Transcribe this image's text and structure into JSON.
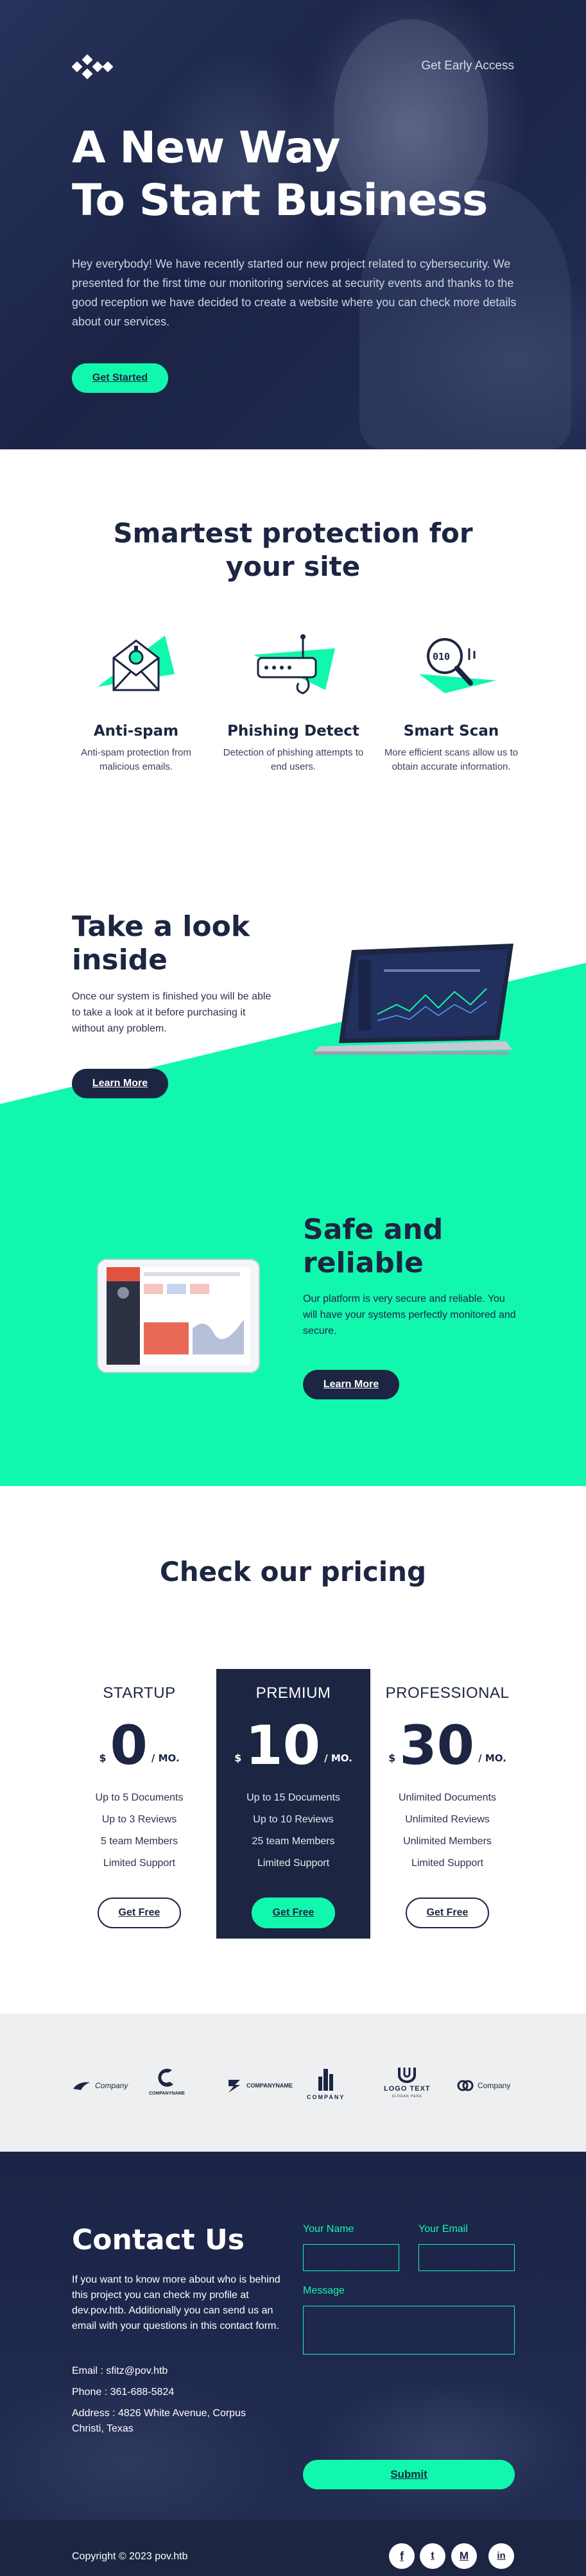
{
  "nav": {
    "link": "Get Early Access"
  },
  "hero": {
    "title_line1": "A New Way",
    "title_line2": "To Start Business",
    "text": "Hey everybody! We have recently started our new project related to cybersecurity. We presented for the first time our monitoring services at security events and thanks to the good reception we have decided to create a website where you can check more details about our services.",
    "button": "Get Started"
  },
  "features": {
    "title": "Smartest protection for your site",
    "items": [
      {
        "icon": "envelope-icon",
        "title": "Anti-spam",
        "desc": "Anti-spam protection from malicious emails."
      },
      {
        "icon": "router-icon",
        "title": "Phishing Detect",
        "desc": "Detection of phishing attempts to end users."
      },
      {
        "icon": "magnifier-icon",
        "title": "Smart Scan",
        "desc": "More efficient scans allow us to obtain accurate information."
      }
    ]
  },
  "inside": {
    "title_line1": "Take a look",
    "title_line2": "inside",
    "text": "Once our system is finished you will be able to take a look at it before purchasing it without any problem.",
    "button": "Learn More"
  },
  "safe": {
    "title_line1": "Safe and",
    "title_line2": "reliable",
    "text": "Our platform is very secure and reliable. You will have your systems perfectly monitored and secure.",
    "button": "Learn More"
  },
  "pricing": {
    "title": "Check our pricing",
    "plans": [
      {
        "name": "STARTUP",
        "currency": "$",
        "price": "0",
        "per": "/ MO.",
        "features": [
          "Up to 5 Documents",
          "Up to 3 Reviews",
          "5 team Members",
          "Limited Support"
        ],
        "button": "Get Free"
      },
      {
        "name": "PREMIUM",
        "currency": "$",
        "price": "10",
        "per": "/ MO.",
        "features": [
          "Up to 15 Documents",
          "Up to 10 Reviews",
          "25 team Members",
          "Limited Support"
        ],
        "button": "Get Free"
      },
      {
        "name": "PROFESSIONAL",
        "currency": "$",
        "price": "30",
        "per": "/ MO.",
        "features": [
          "Unlimited Documents",
          "Unlimited Reviews",
          "Unlimited Members",
          "Limited Support"
        ],
        "button": "Get Free"
      }
    ]
  },
  "logos": [
    {
      "label": "Company"
    },
    {
      "label": "COMPANYNAME"
    },
    {
      "label": "COMPANYNAME"
    },
    {
      "label": "COMPANY"
    },
    {
      "label": "LOGO TEXT",
      "tagline": "SLOGAN HERE"
    },
    {
      "label": "Company"
    }
  ],
  "contact": {
    "title": "Contact Us",
    "text": "If you want to know more about who is behind this project you can check my profile at dev.pov.htb. Additionally you can send us an email with your questions in this contact form.",
    "email": "Email : sfitz@pov.htb",
    "phone": "Phone : 361-688-5824",
    "address": "Address : 4826 White Avenue, Corpus Christi, Texas",
    "name_label": "Your Name",
    "email_label": "Your Email",
    "message_label": "Message",
    "submit": "Submit"
  },
  "footer": {
    "copyright": "Copyright © 2023 pov.htb",
    "social": [
      {
        "icon": "facebook-icon",
        "glyph": "f"
      },
      {
        "icon": "twitter-icon",
        "glyph": "t"
      },
      {
        "icon": "medium-icon",
        "glyph": "M"
      },
      {
        "icon": "linkedin-icon",
        "glyph": "in"
      }
    ]
  },
  "colors": {
    "navy": "#1c2541",
    "accent": "#12f7ae",
    "grey_band": "#eeeff1"
  }
}
